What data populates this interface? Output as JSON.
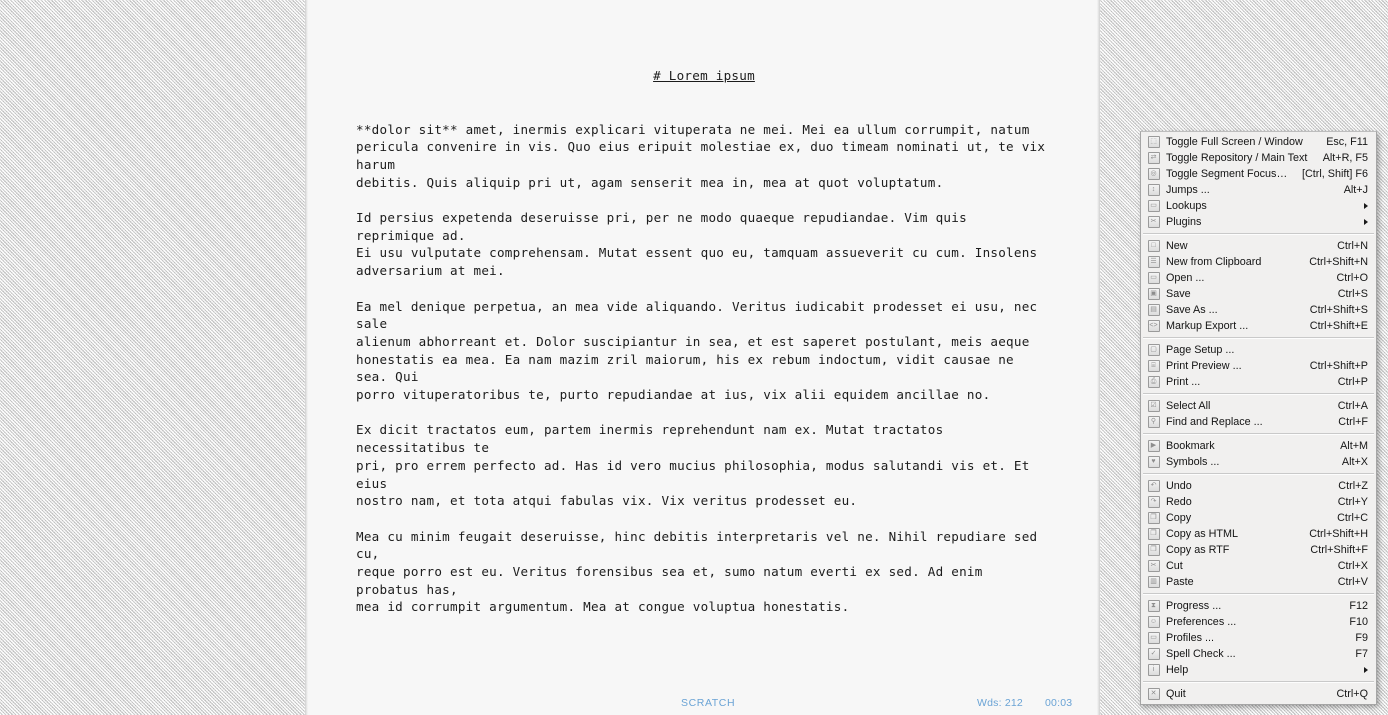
{
  "window": {
    "page_background": "#f7f7f7",
    "outer_background": "#e8e8e8"
  },
  "document": {
    "heading": "# Lorem ipsum",
    "paragraphs": [
      "**dolor sit** amet, inermis explicari vituperata ne mei. Mei ea ullum corrumpit, natum\npericula convenire in vis. Quo eius eripuit molestiae ex, duo timeam nominati ut, te vix harum\ndebitis. Quis aliquip pri ut, agam senserit mea in, mea at quot voluptatum.",
      "Id persius expetenda deseruisse pri, per ne modo quaeque repudiandae. Vim quis reprimique ad.\nEi usu vulputate comprehensam. Mutat essent quo eu, tamquam assueverit cu cum. Insolens\nadversarium at mei.",
      "Ea mel denique perpetua, an mea vide aliquando. Veritus iudicabit prodesset ei usu, nec sale\nalienum abhorreant et. Dolor suscipiantur in sea, et est saperet postulant, meis aeque\nhonestatis ea mea. Ea nam mazim zril maiorum, his ex rebum indoctum, vidit causae ne sea. Qui\nporro vituperatoribus te, purto repudiandae at ius, vix alii equidem ancillae no.",
      "Ex dicit tractatos eum, partem inermis reprehendunt nam ex. Mutat tractatos necessitatibus te\npri, pro errem perfecto ad. Has id vero mucius philosophia, modus salutandi vis et. Et eius\nnostro nam, et tota atqui fabulas vix. Vix veritus prodesset eu.",
      "Mea cu minim feugait deseruisse, hinc debitis interpretaris vel ne. Nihil repudiare sed cu,\nreque porro est eu. Veritus forensibus sea et, sumo natum everti ex sed. Ad enim probatus has,\nmea id corrumpit argumentum. Mea at congue voluptua honestatis."
    ]
  },
  "status_bar": {
    "document_name": "SCRATCH",
    "word_count": "Wds: 212",
    "timer": "00:03",
    "color": "#6aa3d5"
  },
  "context_menu": {
    "groups": [
      {
        "items": [
          {
            "icon": "fullscreen-icon",
            "glyph": "⬚",
            "label": "Toggle Full Screen / Window",
            "accel": "Esc, F11",
            "submenu": false
          },
          {
            "icon": "repository-icon",
            "glyph": "⇄",
            "label": "Toggle Repository / Main Text",
            "accel": "Alt+R, F5",
            "submenu": false
          },
          {
            "icon": "segment-focus-icon",
            "glyph": "◎",
            "label": "Toggle Segment Focus On / Off",
            "accel": "[Ctrl, Shift] F6",
            "submenu": false
          },
          {
            "icon": "jumps-icon",
            "glyph": "↕",
            "label": "Jumps ...",
            "accel": "Alt+J",
            "submenu": false
          },
          {
            "icon": "lookups-icon",
            "glyph": "▭",
            "label": "Lookups",
            "accel": "",
            "submenu": true
          },
          {
            "icon": "plugins-icon",
            "glyph": "✂",
            "label": "Plugins",
            "accel": "",
            "submenu": true
          }
        ]
      },
      {
        "items": [
          {
            "icon": "new-file-icon",
            "glyph": "□",
            "label": "New",
            "accel": "Ctrl+N",
            "submenu": false
          },
          {
            "icon": "new-clipboard-icon",
            "glyph": "☰",
            "label": "New from Clipboard",
            "accel": "Ctrl+Shift+N",
            "submenu": false
          },
          {
            "icon": "open-folder-icon",
            "glyph": "▭",
            "label": "Open ...",
            "accel": "Ctrl+O",
            "submenu": false
          },
          {
            "icon": "save-icon",
            "glyph": "▣",
            "label": "Save",
            "accel": "Ctrl+S",
            "submenu": false
          },
          {
            "icon": "save-as-icon",
            "glyph": "▤",
            "label": "Save As ...",
            "accel": "Ctrl+Shift+S",
            "submenu": false
          },
          {
            "icon": "markup-export-icon",
            "glyph": "<>",
            "label": "Markup Export ...",
            "accel": "Ctrl+Shift+E",
            "submenu": false
          }
        ]
      },
      {
        "items": [
          {
            "icon": "page-setup-icon",
            "glyph": "▢",
            "label": "Page Setup ...",
            "accel": "",
            "submenu": false
          },
          {
            "icon": "print-preview-icon",
            "glyph": "⌸",
            "label": "Print Preview ...",
            "accel": "Ctrl+Shift+P",
            "submenu": false
          },
          {
            "icon": "print-icon",
            "glyph": "⎙",
            "label": "Print ...",
            "accel": "Ctrl+P",
            "submenu": false
          }
        ]
      },
      {
        "items": [
          {
            "icon": "select-all-icon",
            "glyph": "☑",
            "label": "Select All",
            "accel": "Ctrl+A",
            "submenu": false
          },
          {
            "icon": "find-replace-icon",
            "glyph": "⚲",
            "label": "Find and Replace ...",
            "accel": "Ctrl+F",
            "submenu": false
          }
        ]
      },
      {
        "items": [
          {
            "icon": "bookmark-icon",
            "glyph": "▶",
            "label": "Bookmark",
            "accel": "Alt+M",
            "submenu": false
          },
          {
            "icon": "symbols-icon",
            "glyph": "♥",
            "label": "Symbols ...",
            "accel": "Alt+X",
            "submenu": false
          }
        ]
      },
      {
        "items": [
          {
            "icon": "undo-icon",
            "glyph": "↶",
            "label": "Undo",
            "accel": "Ctrl+Z",
            "submenu": false
          },
          {
            "icon": "redo-icon",
            "glyph": "↷",
            "label": "Redo",
            "accel": "Ctrl+Y",
            "submenu": false
          },
          {
            "icon": "copy-icon",
            "glyph": "❐",
            "label": "Copy",
            "accel": "Ctrl+C",
            "submenu": false
          },
          {
            "icon": "copy-html-icon",
            "glyph": "❐",
            "label": "Copy as HTML",
            "accel": "Ctrl+Shift+H",
            "submenu": false
          },
          {
            "icon": "copy-rtf-icon",
            "glyph": "❐",
            "label": "Copy as RTF",
            "accel": "Ctrl+Shift+F",
            "submenu": false
          },
          {
            "icon": "cut-icon",
            "glyph": "✂",
            "label": "Cut",
            "accel": "Ctrl+X",
            "submenu": false
          },
          {
            "icon": "paste-icon",
            "glyph": "▥",
            "label": "Paste",
            "accel": "Ctrl+V",
            "submenu": false
          }
        ]
      },
      {
        "items": [
          {
            "icon": "progress-icon",
            "glyph": "⧗",
            "label": "Progress ...",
            "accel": "F12",
            "submenu": false
          },
          {
            "icon": "preferences-icon",
            "glyph": "☺",
            "label": "Preferences ...",
            "accel": "F10",
            "submenu": false
          },
          {
            "icon": "profiles-icon",
            "glyph": "▭",
            "label": "Profiles ...",
            "accel": "F9",
            "submenu": false
          },
          {
            "icon": "spell-check-icon",
            "glyph": "✓",
            "label": "Spell Check ...",
            "accel": "F7",
            "submenu": false
          },
          {
            "icon": "help-icon",
            "glyph": "i",
            "label": "Help",
            "accel": "",
            "submenu": true
          }
        ]
      },
      {
        "items": [
          {
            "icon": "quit-icon",
            "glyph": "✕",
            "label": "Quit",
            "accel": "Ctrl+Q",
            "submenu": false
          }
        ]
      }
    ]
  }
}
